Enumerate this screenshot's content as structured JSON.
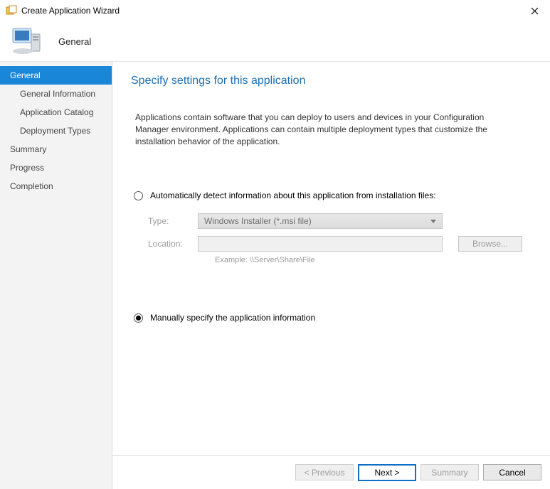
{
  "window": {
    "title": "Create Application Wizard"
  },
  "header": {
    "stepName": "General"
  },
  "sidebar": {
    "items": [
      {
        "label": "General",
        "active": true,
        "sub": false
      },
      {
        "label": "General Information",
        "active": false,
        "sub": true
      },
      {
        "label": "Application Catalog",
        "active": false,
        "sub": true
      },
      {
        "label": "Deployment Types",
        "active": false,
        "sub": true
      },
      {
        "label": "Summary",
        "active": false,
        "sub": false
      },
      {
        "label": "Progress",
        "active": false,
        "sub": false
      },
      {
        "label": "Completion",
        "active": false,
        "sub": false
      }
    ]
  },
  "content": {
    "heading": "Specify settings for this application",
    "description": "Applications contain software that you can deploy to users and devices in your Configuration Manager environment. Applications can contain multiple deployment types that customize the installation behavior of the application.",
    "optionAuto": {
      "label": "Automatically detect information about this application from installation files:",
      "checked": false
    },
    "typeLabel": "Type:",
    "typeValue": "Windows Installer (*.msi file)",
    "locationLabel": "Location:",
    "locationValue": "",
    "browseLabel": "Browse...",
    "exampleText": "Example: \\\\Server\\Share\\File",
    "optionManual": {
      "label": "Manually specify the application information",
      "checked": true
    }
  },
  "footer": {
    "previous": "< Previous",
    "next": "Next >",
    "summary": "Summary",
    "cancel": "Cancel"
  }
}
